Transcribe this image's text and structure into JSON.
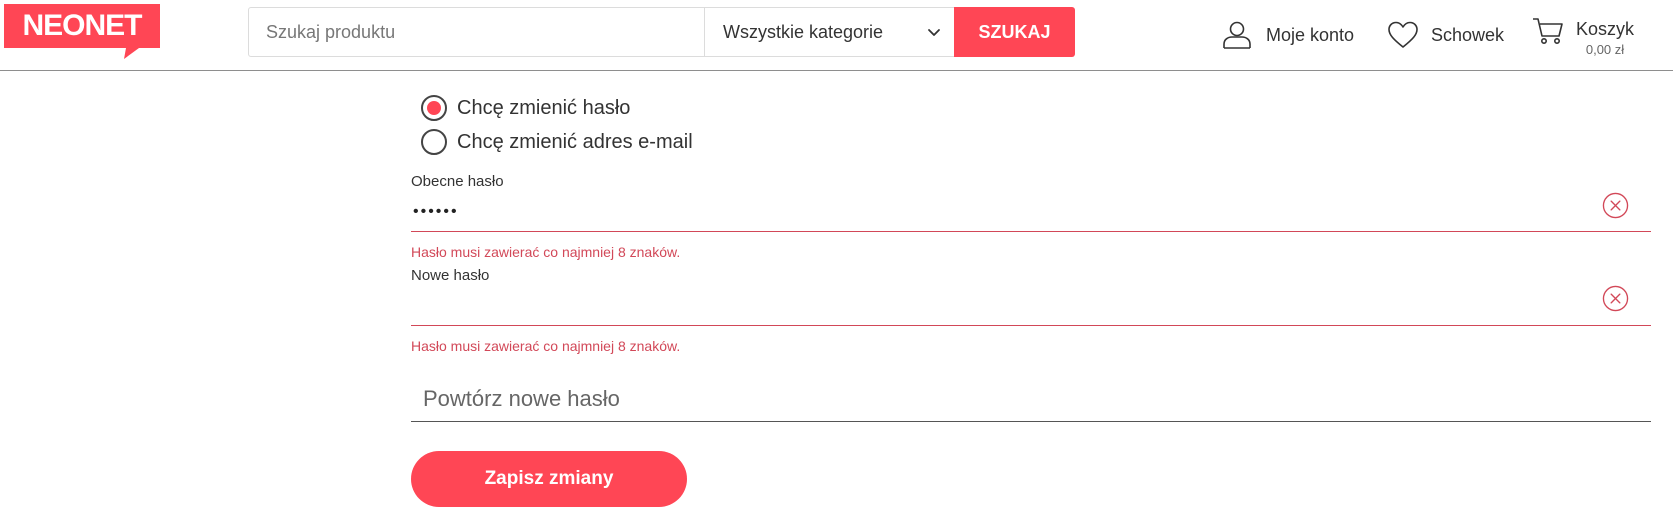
{
  "header": {
    "logo_text": "NEONET",
    "search": {
      "placeholder": "Szukaj produktu",
      "category_selected": "Wszystkie kategorie",
      "button_label": "SZUKAJ"
    },
    "account_label": "Moje konto",
    "wishlist_label": "Schowek",
    "cart_label": "Koszyk",
    "cart_amount": "0,00 zł"
  },
  "form": {
    "radio_options": [
      {
        "label": "Chcę zmienić hasło",
        "checked": true
      },
      {
        "label": "Chcę zmienić adres e-mail",
        "checked": false
      }
    ],
    "current_password": {
      "label": "Obecne hasło",
      "value": "••••••",
      "error": "Hasło musi zawierać co najmniej 8 znaków."
    },
    "new_password": {
      "label": "Nowe hasło",
      "value": "",
      "error": "Hasło musi zawierać co najmniej 8 znaków."
    },
    "repeat_password": {
      "placeholder": "Powtórz nowe hasło"
    },
    "save_label": "Zapisz zmiany"
  },
  "colors": {
    "brand": "#ff4655",
    "error": "#d24858",
    "text": "#333333"
  },
  "icons": {
    "account": "user-icon",
    "wishlist": "heart-icon",
    "cart": "cart-icon",
    "clear": "circle-x-icon",
    "select": "chevron-down-icon"
  }
}
